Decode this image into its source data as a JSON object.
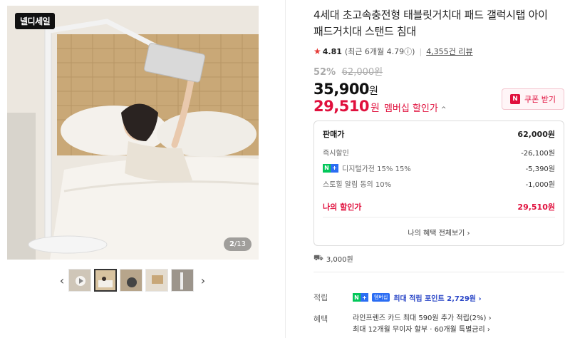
{
  "gallery": {
    "badge": "넬디세일",
    "page_current": "2",
    "page_total": "/13",
    "prev_arrow": "‹",
    "next_arrow": "›"
  },
  "product": {
    "title": "4세대 초고속충전형 태블릿거치대 패드 갤럭시탭 아이패드거치대 스탠드 침대",
    "rating": "4.81",
    "recent_rating": "(최근 6개월 4.79",
    "info_mark": "ⓘ",
    "recent_rating_close": ")",
    "review_count": "4,355건 리뷰"
  },
  "price": {
    "discount_rate": "52%",
    "original_price": "62,000원",
    "sale_price": "35,900",
    "sale_unit": "원",
    "member_price": "29,510",
    "member_unit": "원",
    "member_label": "멤버십 할인가",
    "member_caret": "^"
  },
  "coupon": {
    "icon_letter": "N",
    "label": "쿠폰 받기"
  },
  "breakdown": {
    "rows": [
      {
        "label": "판매가",
        "value": "62,000원"
      },
      {
        "label": "즉시할인",
        "value": "-26,100원"
      },
      {
        "label": "디지털가전 15% 15%",
        "value": "-5,390원"
      },
      {
        "label": "스토힐 알림 동의 10%",
        "value": "-1,000원"
      },
      {
        "label": "나의 할인가",
        "value": "29,510원"
      }
    ],
    "np_badge": [
      "N",
      "+"
    ],
    "more_label": "나의 혜택 전체보기 ›"
  },
  "shipping": {
    "fee": "3,000원"
  },
  "points": {
    "key": "적립",
    "badge_n": "N",
    "badge_plus": "+",
    "member_tag": "멤버십",
    "value": "최대 적립 포인트 2,729원 ›"
  },
  "benefits": {
    "key": "혜택",
    "lines": [
      "라인프렌즈 카드 최대 590원 추가 적립(2%) ›",
      "최대 12개월 무이자 할부 · 60개월 특별금리 ›"
    ]
  },
  "colors": {
    "accent_red": "#e0103d",
    "naver_green": "#03c75a",
    "naver_blue": "#2b6df3"
  }
}
